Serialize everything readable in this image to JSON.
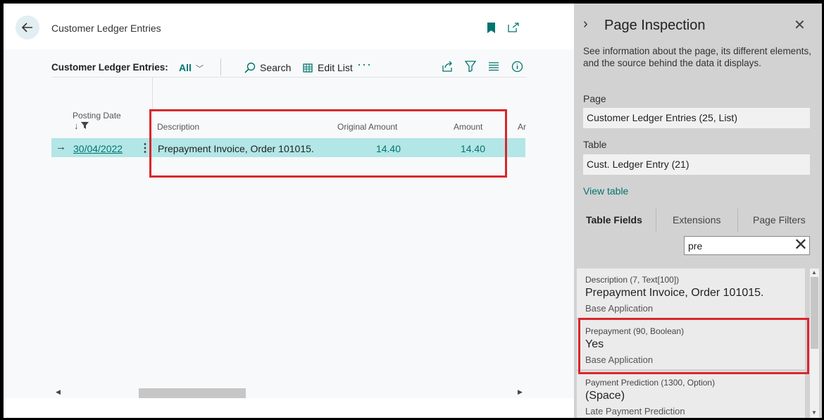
{
  "header": {
    "title": "Customer Ledger Entries"
  },
  "toolbar": {
    "caption": "Customer Ledger Entries:",
    "view": "All",
    "search_label": "Search",
    "edit_list_label": "Edit List",
    "more": "···"
  },
  "list": {
    "columns": {
      "posting_date": "Posting Date",
      "description": "Description",
      "original_amount": "Original Amount",
      "amount": "Amount",
      "next_col_partial": "Ar"
    },
    "rows": [
      {
        "posting_date": "30/04/2022",
        "description": "Prepayment Invoice, Order 101015.",
        "original_amount": "14.40",
        "amount": "14.40"
      }
    ]
  },
  "panel": {
    "title": "Page Inspection",
    "description": "See information about the page, its different elements, and the source behind the data it displays.",
    "page_label": "Page",
    "page_value": "Customer Ledger Entries (25, List)",
    "table_label": "Table",
    "table_value": "Cust. Ledger Entry (21)",
    "view_table_link": "View table",
    "tabs": [
      "Table Fields",
      "Extensions",
      "Page Filters"
    ],
    "filter_value": "pre",
    "fields": [
      {
        "caption": "Description (7, Text[100])",
        "value": "Prepayment Invoice, Order 101015.",
        "source": "Base Application"
      },
      {
        "caption": "Prepayment (90, Boolean)",
        "value": "Yes",
        "source": "Base Application"
      },
      {
        "caption": "Payment Prediction (1300, Option)",
        "value": "(Space)",
        "source": "Late Payment Prediction"
      }
    ]
  },
  "colors": {
    "accent": "#00756f",
    "highlight_row": "#b3e6e6",
    "annotation_red": "#d9262d",
    "panel_bg": "#d2d2d2"
  }
}
